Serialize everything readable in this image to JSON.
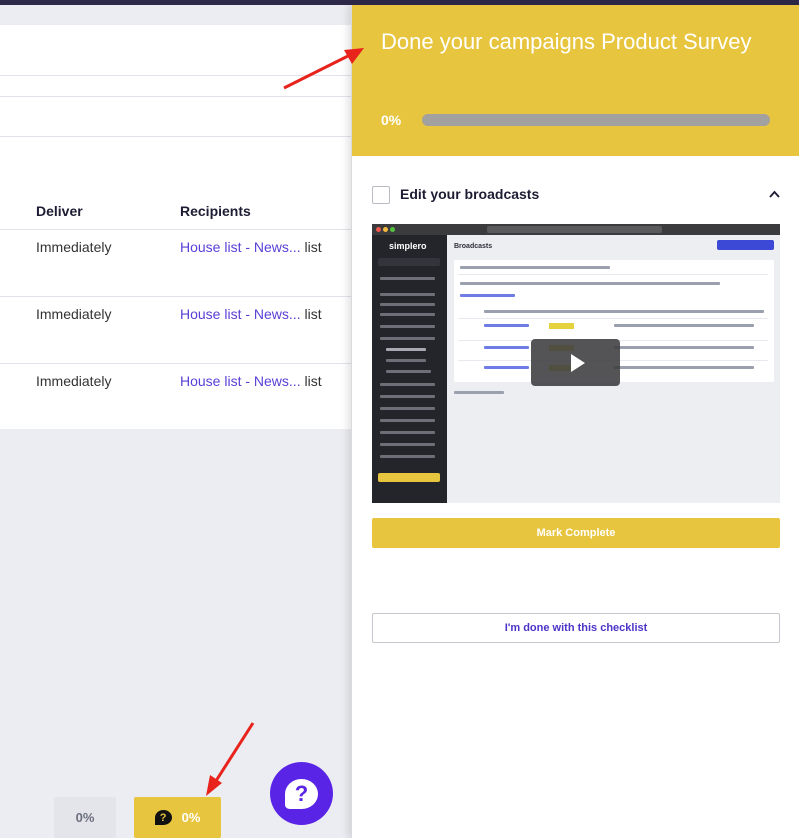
{
  "background": {
    "table_headers": {
      "deliver": "Deliver",
      "recipients": "Recipients"
    },
    "rows": [
      {
        "deliver": "Immediately",
        "recipient_link": "House list - News...",
        "recipient_suffix": "list"
      },
      {
        "deliver": "Immediately",
        "recipient_link": "House list - News...",
        "recipient_suffix": "list"
      },
      {
        "deliver": "Immediately",
        "recipient_link": "House list - News...",
        "recipient_suffix": "list"
      }
    ]
  },
  "floating": {
    "progress_pill_gray": "0%",
    "progress_pill_yellow": "0%",
    "help_icon": "question-bubble-icon",
    "help_glyph": "?"
  },
  "checklist": {
    "title": "Done your campaigns Product Survey",
    "progress_label": "0%",
    "progress_value": 0,
    "task": {
      "label": "Edit your broadcasts",
      "checked": false,
      "expanded": true,
      "video": {
        "app_name": "simplero",
        "page_title": "Broadcasts"
      }
    },
    "mark_complete_label": "Mark Complete",
    "done_label": "I'm done with this checklist"
  },
  "colors": {
    "accent_yellow": "#e8c53f",
    "help_purple": "#5a24e6",
    "link_purple": "#5a3fd6",
    "annotation_red": "#e8231c"
  }
}
